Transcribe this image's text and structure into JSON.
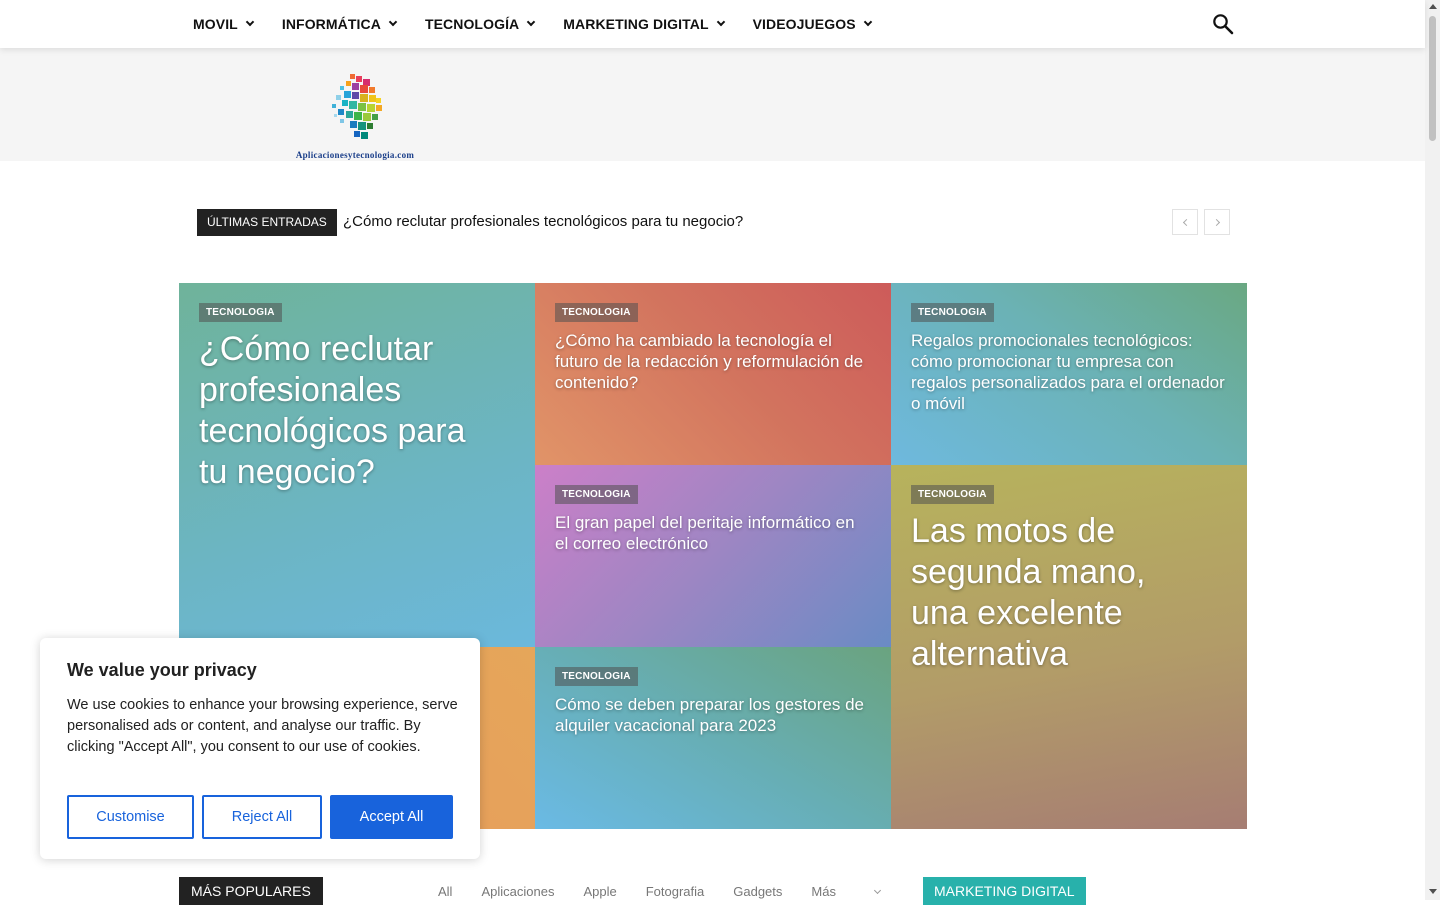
{
  "nav": {
    "items": [
      {
        "label": "MOVIL"
      },
      {
        "label": "INFORMÁTICA"
      },
      {
        "label": "TECNOLOGÍA"
      },
      {
        "label": "MARKETING DIGITAL"
      },
      {
        "label": "VIDEOJUEGOS"
      }
    ],
    "search_icon": "search-icon"
  },
  "logo": {
    "text": "Aplicacionesytecnologia.com"
  },
  "ticker": {
    "label": "ÚLTIMAS ENTRADAS",
    "headline": "¿Cómo reclutar profesionales tecnológicos para tu negocio?"
  },
  "featured": [
    {
      "category": "TECNOLOGIA",
      "title": "¿Cómo reclutar profesionales tecnológicos para tu negocio?"
    },
    {
      "category": "TECNOLOGIA",
      "title": "¿Cómo ha cambiado la tecnología el futuro de la redacción y reformulación de contenido?"
    },
    {
      "category": "TECNOLOGIA",
      "title": "Regalos promocionales tecnológicos: cómo promocionar tu empresa con regalos personalizados para el ordenador o móvil"
    },
    {
      "category": "TECNOLOGIA",
      "title": "El gran papel del peritaje informático en el correo electrónico"
    },
    {
      "category": "TECNOLOGIA",
      "title": "Las motos de segunda mano, una excelente alternativa"
    },
    {
      "category": "TECNOLOGIA",
      "title": "Cómo se deben preparar los gestores de alquiler vacacional para 2023"
    }
  ],
  "popular": {
    "label": "MÁS POPULARES",
    "tabs": [
      "All",
      "Aplicaciones",
      "Apple",
      "Fotografia",
      "Gadgets",
      "Más"
    ]
  },
  "sidebar_heading": "MARKETING DIGITAL",
  "cookie": {
    "title": "We value your privacy",
    "body": "We use cookies to enhance your browsing experience, serve personalised ads or content, and analyse our traffic. By clicking \"Accept All\", you consent to our use of cookies.",
    "customise": "Customise",
    "reject": "Reject All",
    "accept": "Accept All"
  },
  "colors": {
    "accent": "#1863dc",
    "marketing": "#28b1ab",
    "dark": "#222222"
  }
}
